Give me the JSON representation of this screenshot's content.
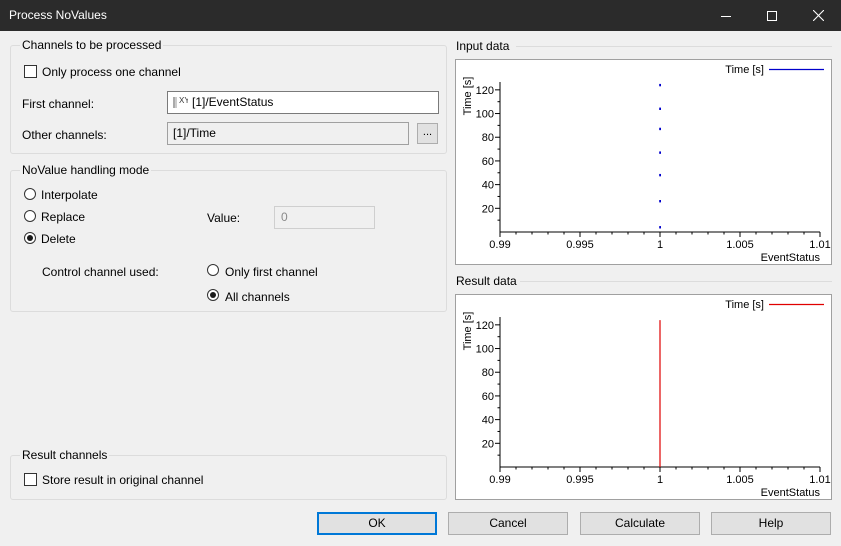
{
  "window": {
    "title": "Process NoValues"
  },
  "channels_group": {
    "label": "Channels to be processed",
    "only_one_channel_label": "Only process one channel",
    "first_channel_label": "First channel:",
    "first_channel_value": "[1]/EventStatus",
    "first_channel_icon": "xy-channel-icon",
    "other_channels_label": "Other channels:",
    "other_channels_value": "[1]/Time",
    "browse_label": "..."
  },
  "novalue_group": {
    "label": "NoValue handling mode",
    "interpolate_label": "Interpolate",
    "replace_label": "Replace",
    "delete_label": "Delete",
    "selected_mode": "Delete",
    "value_label": "Value:",
    "value_field": "0",
    "control_label": "Control channel used:",
    "only_first_label": "Only first channel",
    "all_channels_label": "All channels",
    "selected_control": "All channels"
  },
  "result_group": {
    "label": "Result channels",
    "store_label": "Store result in original channel"
  },
  "input_plot": {
    "label": "Input data",
    "legend": "Time [s]",
    "legend_color": "#0000cc",
    "ylabel": "Time [s]",
    "xlabel": "EventStatus",
    "xticks": [
      "0.99",
      "0.995",
      "1",
      "1.005",
      "1.01"
    ],
    "yticks": [
      "20",
      "40",
      "60",
      "80",
      "100",
      "120"
    ]
  },
  "result_plot": {
    "label": "Result data",
    "legend": "Time [s]",
    "legend_color": "#e00000",
    "ylabel": "Time [s]",
    "xlabel": "EventStatus",
    "xticks": [
      "0.99",
      "0.995",
      "1",
      "1.005",
      "1.01"
    ],
    "yticks": [
      "20",
      "40",
      "60",
      "80",
      "100",
      "120"
    ]
  },
  "chart_data": [
    {
      "type": "scatter",
      "xlabel": "EventStatus",
      "ylabel": "Time [s]",
      "xlim": [
        0.99,
        1.01
      ],
      "ylim": [
        0,
        130
      ],
      "series": [
        {
          "name": "Time [s]",
          "x": [
            1,
            1,
            1,
            1,
            1,
            1,
            1
          ],
          "y": [
            4,
            26,
            48,
            67,
            87,
            104,
            124
          ]
        }
      ]
    },
    {
      "type": "line",
      "xlabel": "EventStatus",
      "ylabel": "Time [s]",
      "xlim": [
        0.99,
        1.01
      ],
      "ylim": [
        0,
        130
      ],
      "series": [
        {
          "name": "Time [s]",
          "x": [
            1,
            1
          ],
          "y": [
            0,
            124
          ]
        }
      ]
    }
  ],
  "buttons": {
    "ok": "OK",
    "cancel": "Cancel",
    "calculate": "Calculate",
    "help": "Help"
  }
}
